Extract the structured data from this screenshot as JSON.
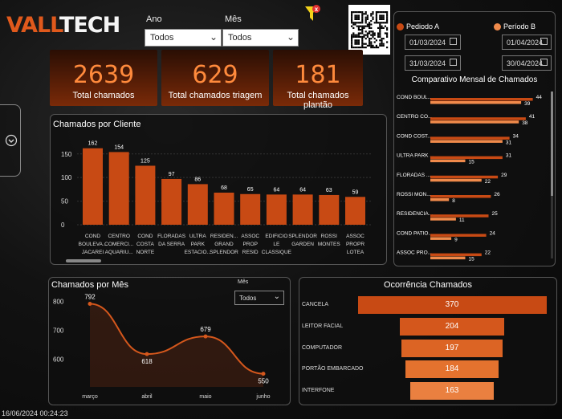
{
  "brand": {
    "part1": "VALL",
    "part2": "TECH"
  },
  "filters": {
    "ano_label": "Ano",
    "ano_value": "Todos",
    "mes_label": "Mês",
    "mes_value": "Todos"
  },
  "kpis": [
    {
      "value": "2639",
      "label": "Total chamados"
    },
    {
      "value": "629",
      "label": "Total chamados triagem"
    },
    {
      "value": "181",
      "label": "Total chamados plantão"
    }
  ],
  "period": {
    "a_label": "Pediodo A",
    "b_label": "Período B",
    "a_start": "01/03/2024",
    "a_end": "31/03/2024",
    "b_start": "01/04/2024",
    "b_end": "30/04/2024",
    "color_a": "#c84a14",
    "color_b": "#f08a4b"
  },
  "comparativo": {
    "title": "Comparativo Mensal de Chamados",
    "rows": [
      {
        "name": "COND BOUL...",
        "a": 44,
        "b": 39
      },
      {
        "name": "CENTRO CO...",
        "a": 41,
        "b": 38
      },
      {
        "name": "COND COST...",
        "a": 34,
        "b": 31
      },
      {
        "name": "ULTRA PARK ...",
        "a": 31,
        "b": 15
      },
      {
        "name": "FLORADAS ...",
        "a": 29,
        "b": 22
      },
      {
        "name": "ROSSI MON...",
        "a": 26,
        "b": 8
      },
      {
        "name": "RESIDENCIA...",
        "a": 25,
        "b": 11
      },
      {
        "name": "COND PATIO...",
        "a": 24,
        "b": 9
      },
      {
        "name": "ASSOC PRO...",
        "a": 22,
        "b": 15
      }
    ]
  },
  "cliente": {
    "title": "Chamados por Cliente",
    "y_ticks": [
      "0",
      "50",
      "100",
      "150"
    ],
    "bar_color": "#c84a14"
  },
  "mes": {
    "title": "Chamados por Mês",
    "filter_label": "Mês",
    "filter_value": "Todos",
    "y_ticks": [
      "600",
      "700",
      "800"
    ]
  },
  "ocorrencia": {
    "title": "Ocorrência Chamados",
    "rows": [
      {
        "label": "CANCELA",
        "value": "370",
        "color": "#c84a14"
      },
      {
        "label": "LEITOR FACIAL",
        "value": "204",
        "color": "#d4571c"
      },
      {
        "label": "COMPUTADOR",
        "value": "197",
        "color": "#dc6424"
      },
      {
        "label": "PORTÃO EMBARCADO",
        "value": "184",
        "color": "#e4722e"
      },
      {
        "label": "INTERFONE",
        "value": "163",
        "color": "#ea8040"
      }
    ]
  },
  "timestamp": "16/06/2024 00:24:23",
  "chart_data": [
    {
      "type": "bar",
      "title": "Chamados por Cliente",
      "categories": [
        "COND BOULEVA... JACAREI",
        "CENTRO COMERCI... AQUARIU...",
        "COND COSTA NORTE O...",
        "FLORADAS DA SERRA",
        "ULTRA PARK ESTACIO...",
        "RESIDEN... GRAND SPLENDOR",
        "ASSOC PROP RESID Al...",
        "EDIFICIO LE CLASSIQUE",
        "SPLENDOR GARDEN",
        "ROSSI MONTES",
        "ASSOC PROPR LOTEA C..."
      ],
      "values": [
        162,
        154,
        125,
        97,
        86,
        68,
        65,
        64,
        64,
        63,
        59
      ],
      "ylim": [
        0,
        170
      ]
    },
    {
      "type": "line",
      "title": "Chamados por Mês",
      "x": [
        "março",
        "abril",
        "maio",
        "junho"
      ],
      "values": [
        792,
        618,
        679,
        550
      ],
      "ylim": [
        560,
        810
      ]
    },
    {
      "type": "bar",
      "title": "Comparativo Mensal de Chamados",
      "categories": [
        "COND BOUL...",
        "CENTRO CO...",
        "COND COST...",
        "ULTRA PARK ...",
        "FLORADAS ...",
        "ROSSI MON...",
        "RESIDENCIA...",
        "COND PATIO...",
        "ASSOC PRO..."
      ],
      "series": [
        {
          "name": "Pediodo A",
          "values": [
            44,
            41,
            34,
            31,
            29,
            26,
            25,
            24,
            22
          ]
        },
        {
          "name": "Período B",
          "values": [
            39,
            38,
            31,
            15,
            22,
            8,
            11,
            9,
            15
          ]
        }
      ]
    },
    {
      "type": "bar",
      "title": "Ocorrência Chamados",
      "categories": [
        "CANCELA",
        "LEITOR FACIAL",
        "COMPUTADOR",
        "PORTÃO EMBARCADO",
        "INTERFONE"
      ],
      "values": [
        370,
        204,
        197,
        184,
        163
      ]
    }
  ]
}
